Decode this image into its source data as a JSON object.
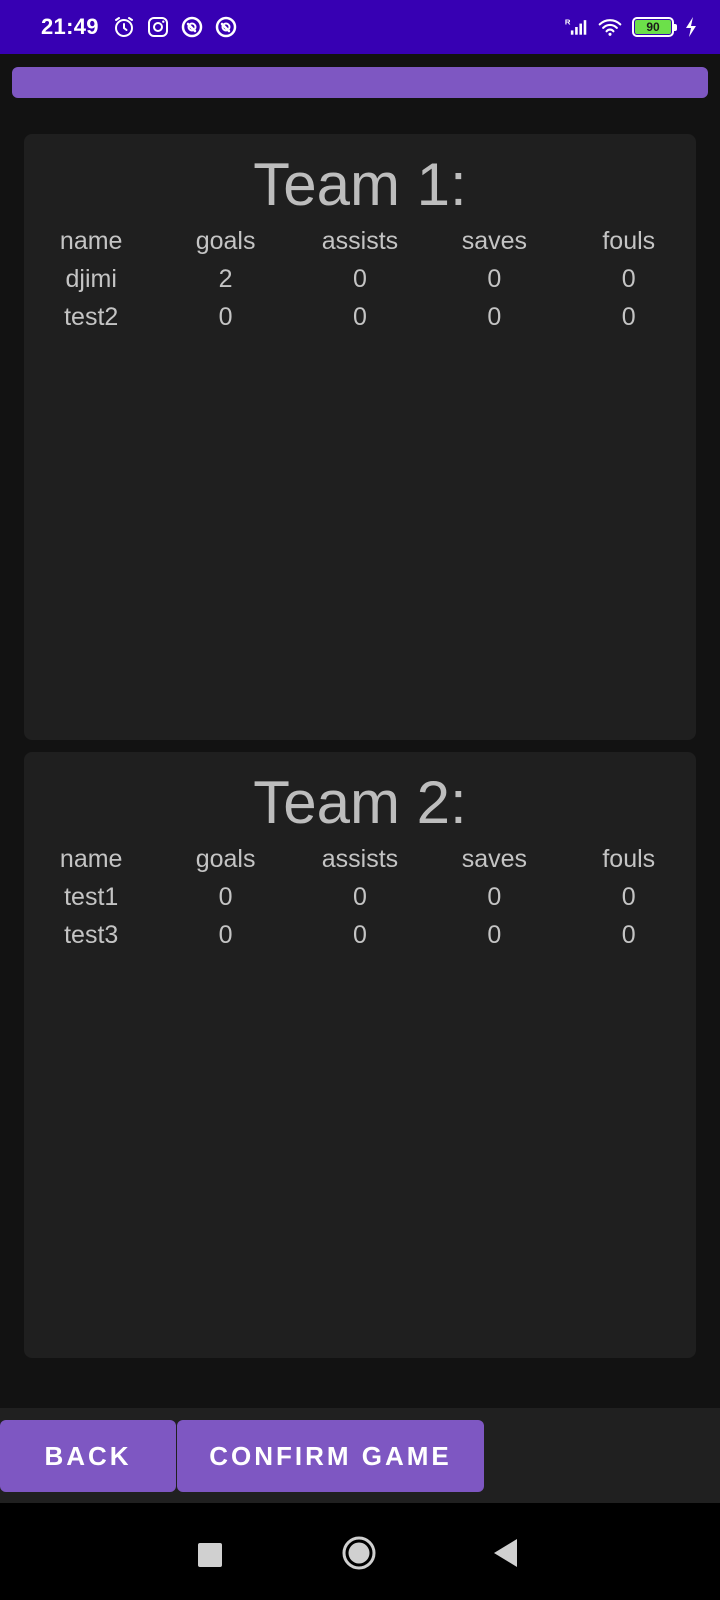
{
  "status_bar": {
    "time": "21:49",
    "battery_level": "90",
    "icons": [
      "alarm-icon",
      "instagram-icon",
      "dnd-icon",
      "dnd-icon",
      "signal-icon",
      "wifi-icon",
      "battery-icon",
      "charging-icon"
    ],
    "background": "#3700b3"
  },
  "progress": {
    "color": "#7e57c2"
  },
  "columns": [
    "name",
    "goals",
    "assists",
    "saves",
    "fouls"
  ],
  "teams": [
    {
      "title": "Team 1:",
      "players": [
        [
          "djimi",
          "2",
          "0",
          "0",
          "0"
        ],
        [
          "test2",
          "0",
          "0",
          "0",
          "0"
        ]
      ]
    },
    {
      "title": "Team 2:",
      "players": [
        [
          "test1",
          "0",
          "0",
          "0",
          "0"
        ],
        [
          "test3",
          "0",
          "0",
          "0",
          "0"
        ]
      ]
    }
  ],
  "buttons": {
    "back": "BACK",
    "confirm": "CONFIRM GAME",
    "color": "#7e57c2"
  },
  "nav_bar": {
    "icons": [
      "recent-apps-icon",
      "home-icon",
      "back-icon"
    ]
  }
}
